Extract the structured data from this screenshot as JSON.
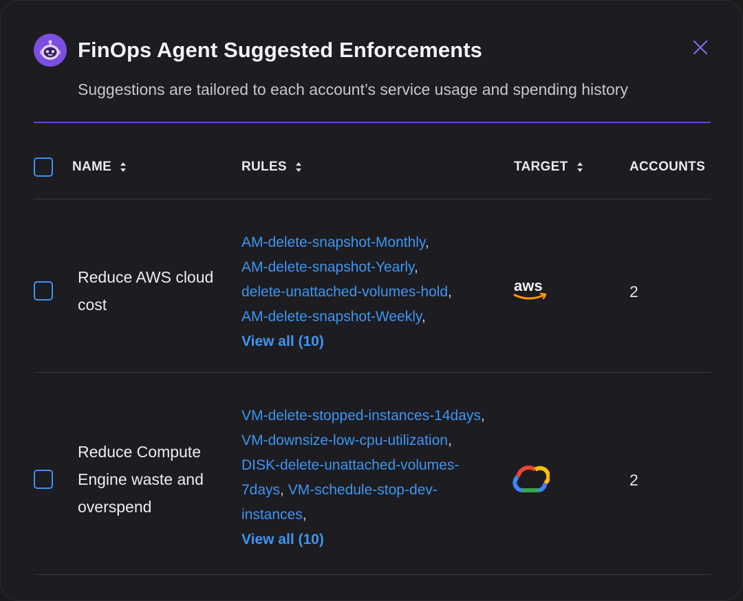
{
  "dialog": {
    "title": "FinOps Agent Suggested Enforcements",
    "subtitle": "Suggestions are tailored to each account’s service usage and spending history",
    "close_icon": "close-icon",
    "avatar_icon": "robot-avatar-icon",
    "accent_color": "#6a43d8",
    "link_color": "#3d96f2"
  },
  "table": {
    "headers": {
      "name": "NAME",
      "rules": "RULES",
      "target": "TARGET",
      "accounts": "ACCOUNTS"
    },
    "rows": [
      {
        "name": "Reduce AWS cloud cost",
        "rules": [
          "AM-delete-snapshot-Monthly",
          "AM-delete-snapshot-Yearly",
          "delete-unattached-volumes-hold",
          "AM-delete-snapshot-Weekly"
        ],
        "view_all": "View all (10)",
        "target": "aws",
        "target_icon": "aws-logo-icon",
        "accounts": "2"
      },
      {
        "name": "Reduce Compute Engine waste and overspend",
        "rules": [
          "VM-delete-stopped-instances-14days",
          "VM-downsize-low-cpu-utilization",
          "DISK-delete-unattached-volumes-7days",
          "VM-schedule-stop-dev-instances"
        ],
        "view_all": "View all (10)",
        "target_icon": "google-cloud-logo-icon",
        "accounts": "2"
      }
    ]
  }
}
